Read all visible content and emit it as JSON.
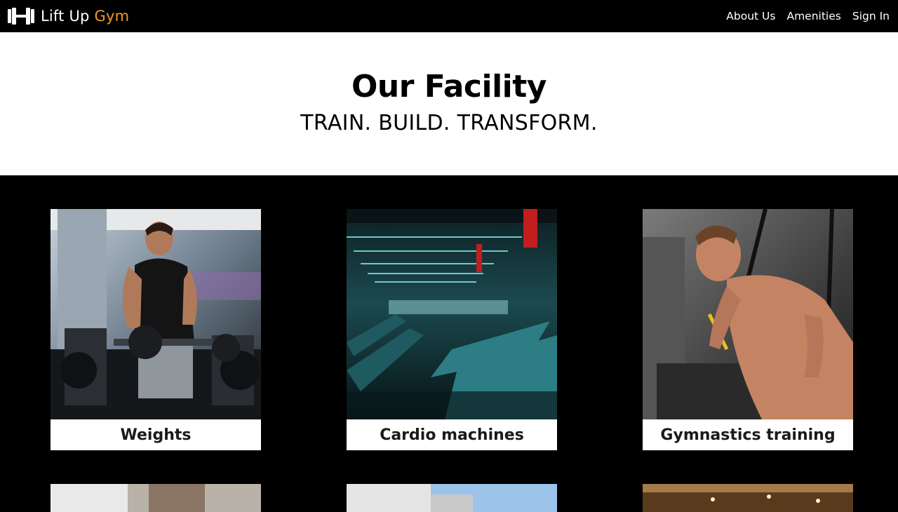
{
  "navbar": {
    "brand_name": "Lift Up",
    "brand_accent": "Gym",
    "links": [
      {
        "label": "About Us"
      },
      {
        "label": "Amenities"
      },
      {
        "label": "Sign In"
      }
    ]
  },
  "hero": {
    "title": "Our Facility",
    "subtitle": "TRAIN. BUILD. TRANSFORM."
  },
  "facilities": [
    {
      "label": "Weights",
      "image": "weights-photo"
    },
    {
      "label": "Cardio machines",
      "image": "cardio-photo"
    },
    {
      "label": "Gymnastics training",
      "image": "gymnastics-photo"
    }
  ],
  "colors": {
    "accent": "#f39a1f",
    "background": "#000000",
    "hero_background": "#ffffff"
  }
}
